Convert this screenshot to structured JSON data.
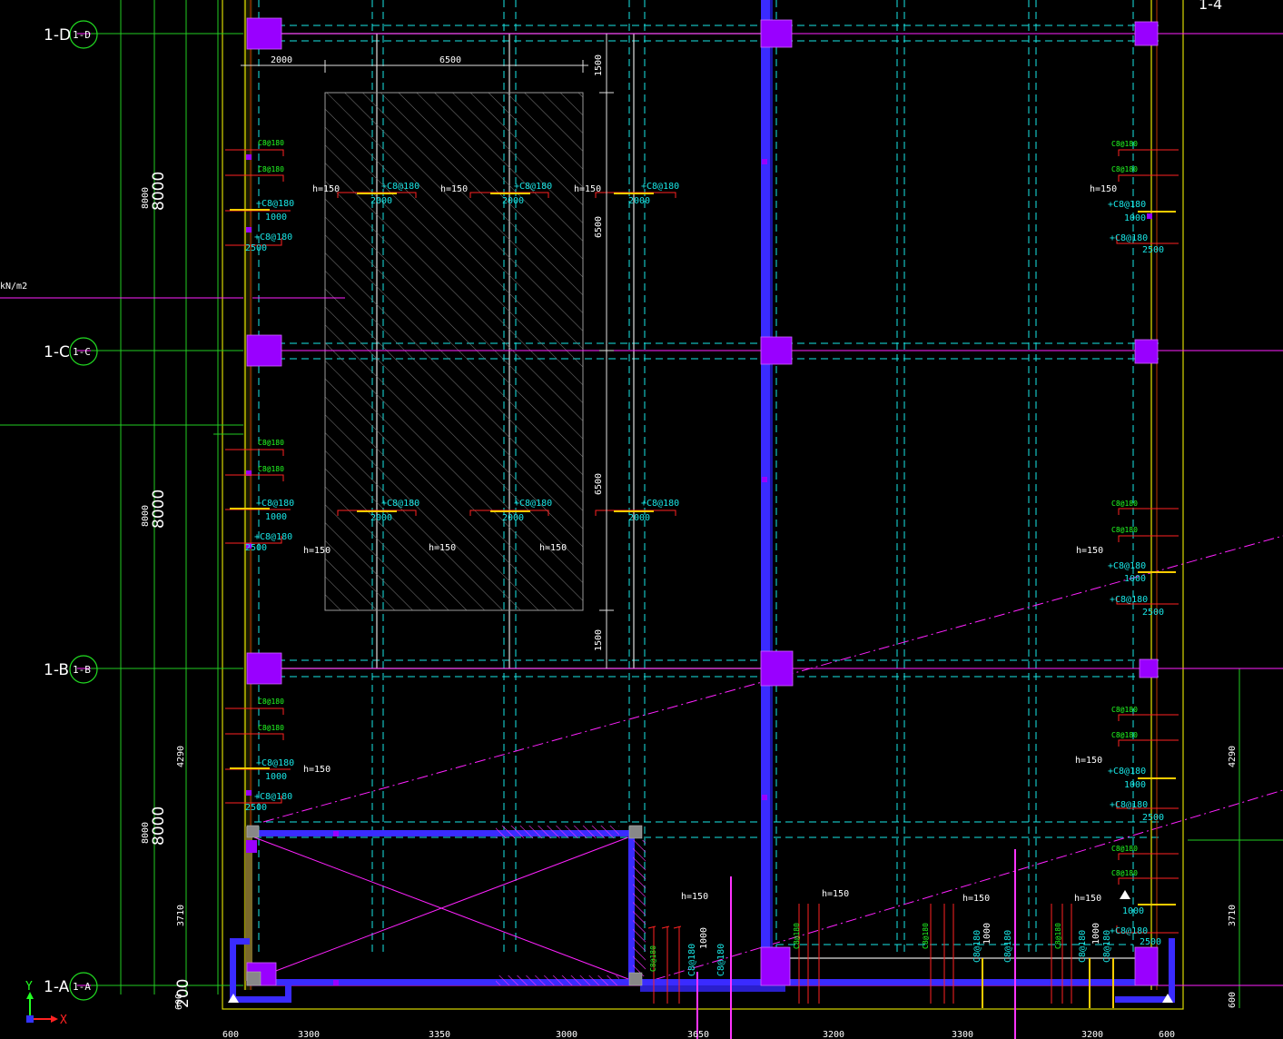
{
  "drawing": {
    "corner_label": "1-4",
    "load_unit": "kN/m2",
    "axes_widget": {
      "y": "Y",
      "x": "X"
    },
    "grid_rows": [
      {
        "id": "1-D",
        "bubble": "1-D"
      },
      {
        "id": "1-C",
        "bubble": "1-C"
      },
      {
        "id": "1-B",
        "bubble": "1-B"
      },
      {
        "id": "1-A",
        "bubble": "1-A"
      }
    ],
    "left_dims": [
      {
        "big": "8000",
        "small": "8000"
      },
      {
        "big": "8000",
        "small": "8000"
      },
      {
        "big": "8000",
        "small": "8000"
      },
      {
        "big": "200",
        "small": "600"
      }
    ],
    "side_subdims": [
      "4290",
      "3710",
      "600"
    ],
    "bottom_dims": [
      "600",
      "3300",
      "3350",
      "3000",
      "3650",
      "3200",
      "3300",
      "3200",
      "600"
    ],
    "opening_dims": {
      "width_left": "2000",
      "width_main": "6500",
      "top": "1500",
      "mid1": "6500",
      "mid2": "6500",
      "bottom": "1500"
    },
    "slab_note": "h=150",
    "rebar_label": "+C8@180",
    "rebar_len": "1000",
    "rebar_len2": "2000",
    "rebar_len3": "2500",
    "green_rebar": "C8@180",
    "colors": {
      "grid_line": "#ff22ff",
      "cyan_dash": "#19e6e6",
      "column": "#9900ff",
      "wall": "#3a2bff",
      "dim_green": "#22dd22",
      "border_yellow": "#e6e600",
      "rebar_red": "#ff2222",
      "rebar_yellow": "#ffcc00"
    }
  }
}
